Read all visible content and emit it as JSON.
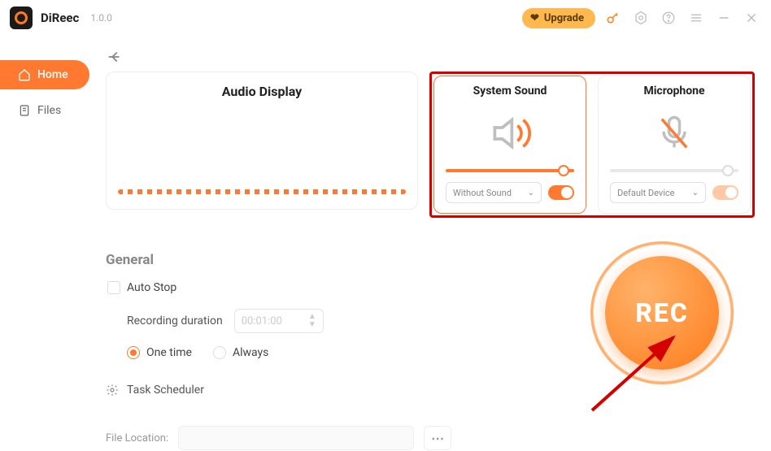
{
  "titlebar": {
    "app_name": "DiReec",
    "version": "1.0.0",
    "upgrade": "Upgrade"
  },
  "sidebar": {
    "items": [
      {
        "label": "Home"
      },
      {
        "label": "Files"
      }
    ]
  },
  "panels": {
    "audio_display": {
      "title": "Audio Display"
    },
    "system_sound": {
      "title": "System Sound",
      "select": "Without Sound",
      "toggle_on": true
    },
    "microphone": {
      "title": "Microphone",
      "select": "Default Device",
      "toggle_on": false
    }
  },
  "general": {
    "title": "General",
    "auto_stop": "Auto Stop",
    "recording_duration_label": "Recording duration",
    "recording_duration_value": "00:01:00",
    "one_time": "One time",
    "always": "Always",
    "task_scheduler": "Task Scheduler",
    "file_location_label": "File Location:"
  },
  "rec": {
    "label": "REC"
  }
}
